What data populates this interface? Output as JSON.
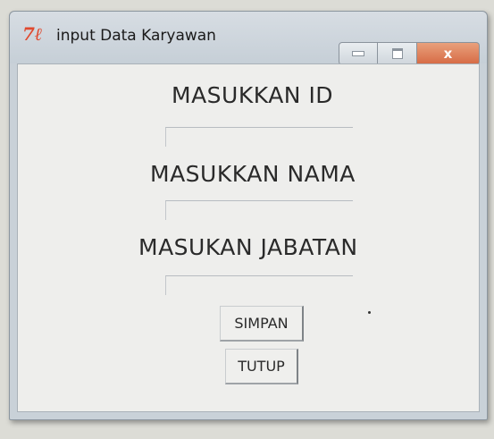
{
  "window": {
    "title": "input Data Karyawan",
    "icon": "java-logo-icon",
    "close_glyph": "x"
  },
  "form": {
    "id_label": "MASUKKAN ID",
    "id_value": "",
    "nama_label": "MASUKKAN NAMA",
    "nama_value": "",
    "jabatan_label": "MASUKAN JABATAN",
    "jabatan_value": ""
  },
  "buttons": {
    "simpan": "SIMPAN",
    "tutup": "TUTUP"
  },
  "colors": {
    "close_button": "#d66a44",
    "icon": "#e0492e"
  }
}
